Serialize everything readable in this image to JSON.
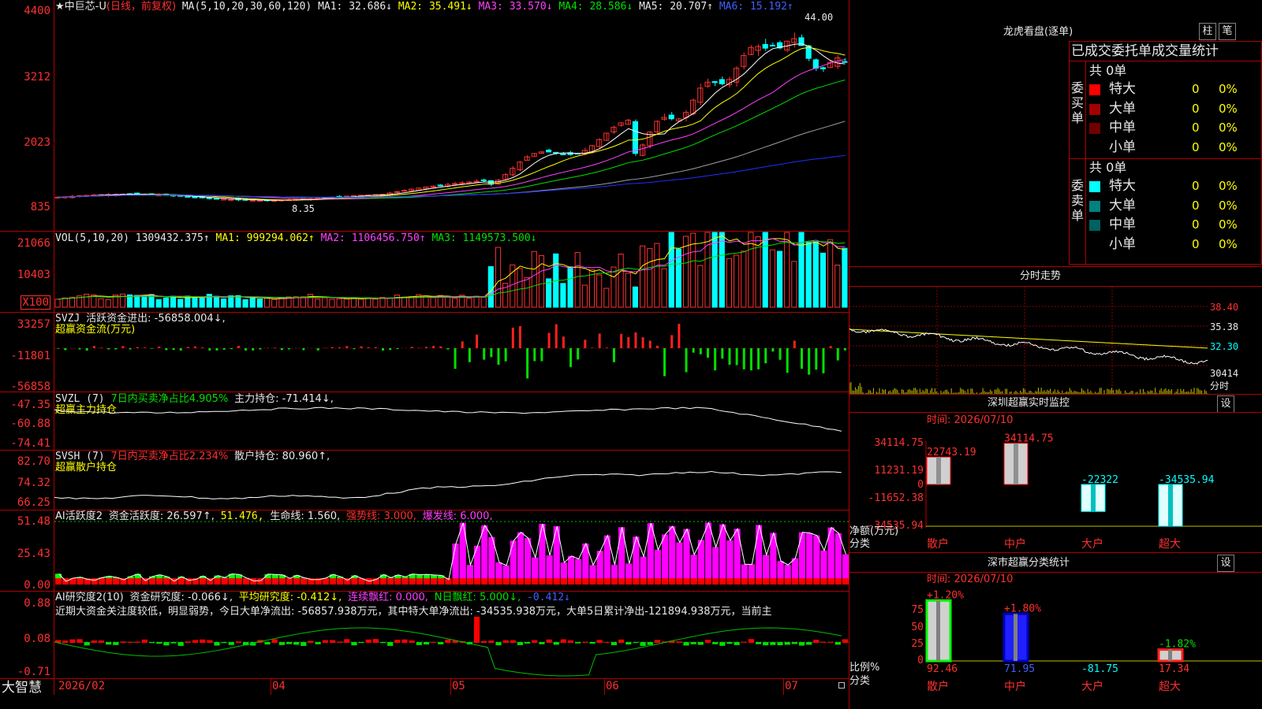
{
  "app_name": "大智慧",
  "main_chart": {
    "title": "★中巨芯-U",
    "period": "(日线，前复权)",
    "ma_label": "MA(5,10,20,30,60,120)",
    "ma1": "MA1: 32.686↓",
    "ma2": "MA2: 35.491↓",
    "ma3": "MA3: 33.570↓",
    "ma4": "MA4: 28.586↓",
    "ma5": "MA5: 20.707↑",
    "ma6": "MA6: 15.192↑",
    "y_ticks": [
      "4400",
      "3212",
      "2023",
      "835"
    ],
    "high_label": "44.00",
    "low_label": "8.35",
    "colors": {
      "ma1": "#ffffff",
      "ma2": "#ffff00",
      "ma3": "#ff40ff",
      "ma4": "#00e000",
      "ma5": "#a0a0a0",
      "ma6": "#2030ff",
      "up": "#ff3030",
      "down": "#00ffff"
    }
  },
  "vol_panel": {
    "label": "VOL(5,10,20)",
    "value": "1309432.375↑",
    "ma1": "MA1: 999294.062↑",
    "ma2": "MA2: 1106456.750↑",
    "ma3": "MA3: 1149573.500↓",
    "y_ticks": [
      "21066",
      "10403"
    ],
    "unit": "X100"
  },
  "svzj_panel": {
    "label": "SVZJ",
    "text": "活跃资金进出: -56858.004↓,",
    "sub": "超赢资金流(万元)",
    "y_ticks": [
      "33257",
      "-11801",
      "-56858"
    ]
  },
  "svzl_panel": {
    "label": "SVZL (7)",
    "ratio": "7日内买卖净占比4.905%",
    "text": "主力持仓: -71.414↓,",
    "sub": "超赢主力持仓",
    "y_ticks": [
      "-47.35",
      "-60.88",
      "-74.41"
    ]
  },
  "svsh_panel": {
    "label": "SVSH (7)",
    "ratio": "7日内买卖净占比2.234%",
    "text": "散户持仓: 80.960↑,",
    "sub": "超赢散户持仓",
    "y_ticks": [
      "82.70",
      "74.32",
      "66.25"
    ]
  },
  "ai_active_panel": {
    "label": "AI活跃度2",
    "t1": "资金活跃度: 26.597↑,",
    "t2": "51.476,",
    "t3": "生命线: 1.560,",
    "t4": "强势线: 3.000,",
    "t5": "爆发线: 6.000,",
    "y_ticks": [
      "51.48",
      "25.43",
      "0.00"
    ]
  },
  "ai_research_panel": {
    "label": "AI研究度2(10)",
    "t1": "资金研究度: -0.066↓,",
    "t2": "平均研究度: -0.412↓,",
    "t3": "连续飘红: 0.000,",
    "t4": "N日飘红: 5.000↓,",
    "t5": "-0.412↓",
    "desc": "近期大资金关注度较低，明显弱势，今日大单净流出: -56857.938万元，其中特大单净流出: -34535.938万元，大单5日累计净出-121894.938万元，当前主",
    "y_ticks": [
      "0.88",
      "0.08",
      "-0.71"
    ]
  },
  "x_axis": {
    "labels": [
      "2026/02",
      "04",
      "05",
      "06",
      "07"
    ]
  },
  "dragon_tiger": {
    "title": "龙虎看盘(逐单)",
    "btn_bar": "柱",
    "btn_pen": "笔",
    "header": "已成交委托单成交量统计",
    "buy": {
      "side_label": "委买单",
      "total": "共 0单",
      "rows": [
        {
          "name": "特大",
          "count": "0",
          "pct": "0%",
          "color": "#ff0000"
        },
        {
          "name": "大单",
          "count": "0",
          "pct": "0%",
          "color": "#a00000"
        },
        {
          "name": "中单",
          "count": "0",
          "pct": "0%",
          "color": "#700000"
        },
        {
          "name": "小单",
          "count": "0",
          "pct": "0%",
          "color": ""
        }
      ]
    },
    "sell": {
      "side_label": "委卖单",
      "total": "共 0单",
      "rows": [
        {
          "name": "特大",
          "count": "0",
          "pct": "0%",
          "color": "#00ffff"
        },
        {
          "name": "大单",
          "count": "0",
          "pct": "0%",
          "color": "#008080"
        },
        {
          "name": "中单",
          "count": "0",
          "pct": "0%",
          "color": "#006060"
        },
        {
          "name": "小单",
          "count": "0",
          "pct": "0%",
          "color": ""
        }
      ]
    }
  },
  "intraday": {
    "title": "分时走势",
    "y_ticks": [
      "38.40",
      "35.38",
      "32.30",
      "30414"
    ],
    "unit": "分时"
  },
  "sz_monitor": {
    "title": "深圳超赢实时监控",
    "set_btn": "设",
    "time": "时间: 2026/07/10",
    "y_ticks": [
      "34114.75",
      "11231.19",
      "0",
      "-11652.38",
      "-34535.94"
    ],
    "ylabel1": "净额(万元)",
    "ylabel2": "分类",
    "categories": [
      "散户",
      "中户",
      "大户",
      "超大"
    ],
    "values": [
      22743.19,
      34114.75,
      -22322,
      -34535.94
    ],
    "value_labels": [
      "22743.19",
      "34114.75",
      "-22322",
      "-34535.94"
    ]
  },
  "sz_stats": {
    "title": "深市超赢分类统计",
    "set_btn": "设",
    "time": "时间: 2026/07/10",
    "y_ticks": [
      "75",
      "50",
      "25",
      "0"
    ],
    "ylabel1": "比例%",
    "ylabel2": "分类",
    "categories": [
      "散户",
      "中户",
      "大户",
      "超大"
    ],
    "top_labels": [
      "+1.20%",
      "+1.80%",
      "",
      "-1.82%"
    ],
    "bottom_values": [
      "92.46",
      "71.95",
      "-81.75",
      "17.34"
    ],
    "values": [
      92.46,
      71.95,
      0,
      17.34
    ]
  }
}
